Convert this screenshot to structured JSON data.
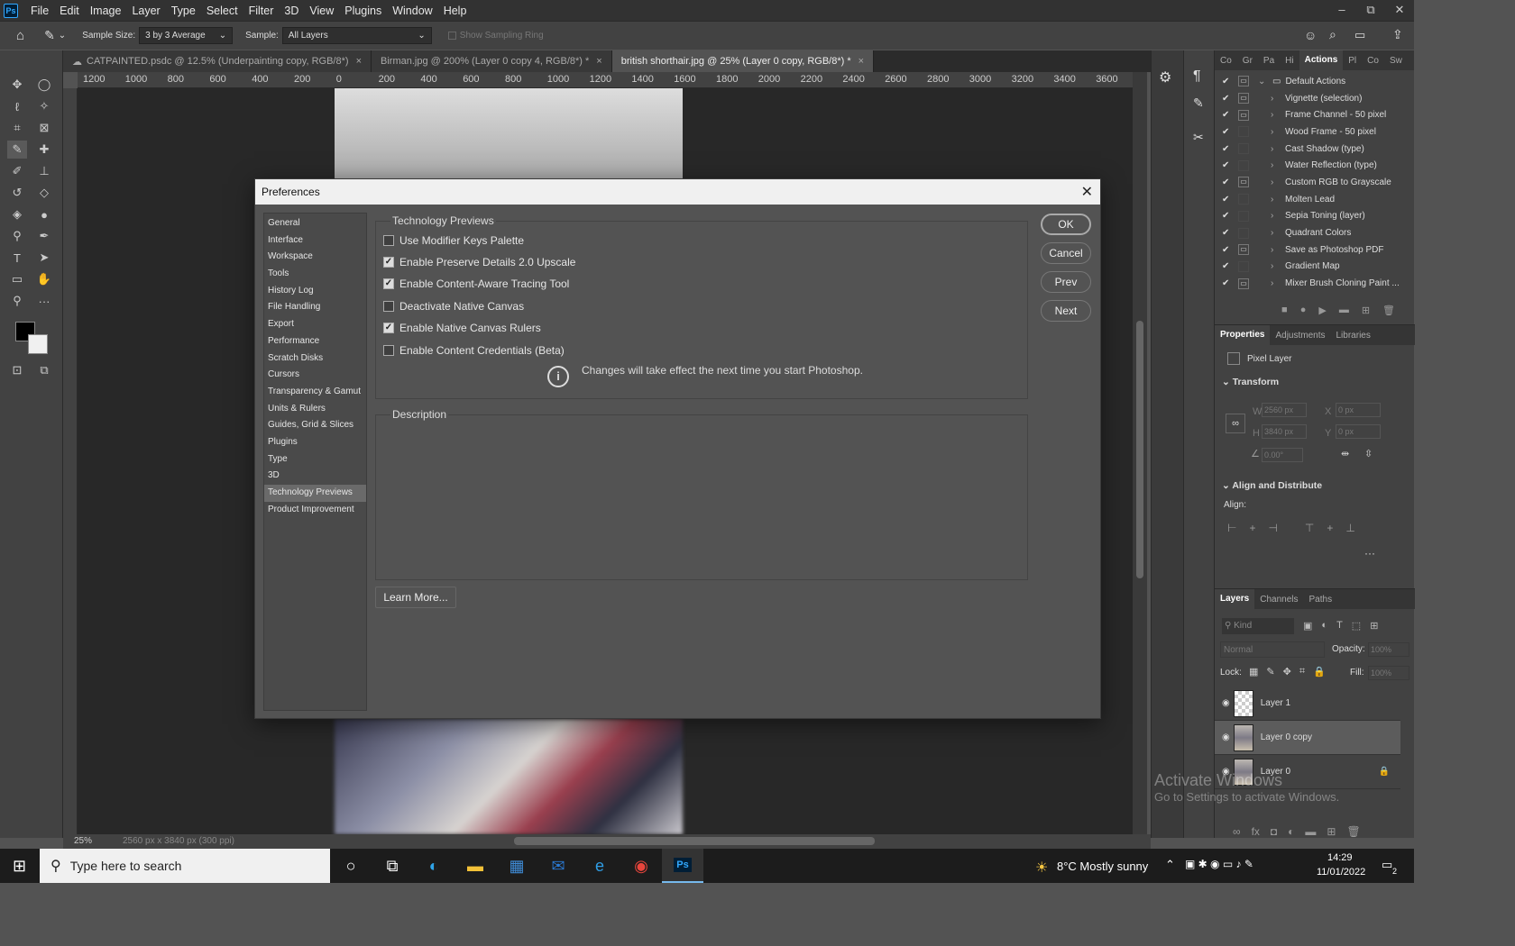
{
  "menubar": {
    "logo": "Ps",
    "items": [
      "File",
      "Edit",
      "Image",
      "Layer",
      "Type",
      "Select",
      "Filter",
      "3D",
      "View",
      "Plugins",
      "Window",
      "Help"
    ],
    "min": "–",
    "max": "⧉",
    "close": "✕"
  },
  "options": {
    "sample_size_label": "Sample Size:",
    "sample_size_value": "3 by 3 Average",
    "sample_label": "Sample:",
    "sample_value": "All Layers",
    "sampling_ring": "Show Sampling Ring"
  },
  "tabs": [
    {
      "label": "CATPAINTED.psdc @ 12.5% (Underpainting copy, RGB/8*)",
      "close": "×"
    },
    {
      "label": "Birman.jpg @ 200% (Layer 0 copy 4, RGB/8*) *",
      "close": "×"
    },
    {
      "label": "british shorthair.jpg @ 25% (Layer 0 copy, RGB/8*) *",
      "close": "×"
    }
  ],
  "ruler": [
    "1200",
    "1000",
    "800",
    "600",
    "400",
    "200",
    "0",
    "200",
    "400",
    "600",
    "800",
    "1000",
    "1200",
    "1400",
    "1600",
    "1800",
    "2000",
    "2200",
    "2400",
    "2600",
    "2800",
    "3000",
    "3200",
    "3400",
    "3600"
  ],
  "status": {
    "zoom": "25%",
    "dims": "2560 px x 3840 px (300 ppi)"
  },
  "actions_panel": {
    "tabs": [
      "Co",
      "Gr",
      "Pa",
      "Hi",
      "Actions",
      "Pl",
      "Co",
      "Sw"
    ],
    "set": "Default Actions",
    "items": [
      "Vignette (selection)",
      "Frame Channel - 50 pixel",
      "Wood Frame - 50 pixel",
      "Cast Shadow (type)",
      "Water Reflection (type)",
      "Custom RGB to Grayscale",
      "Molten Lead",
      "Sepia Toning (layer)",
      "Quadrant Colors",
      "Save as Photoshop PDF",
      "Gradient Map",
      "Mixer Brush Cloning Paint ..."
    ]
  },
  "properties": {
    "tabs": [
      "Properties",
      "Adjustments",
      "Libraries"
    ],
    "kind": "Pixel Layer",
    "transform": "Transform",
    "w_label": "W",
    "w": "2560 px",
    "h_label": "H",
    "h": "3840 px",
    "x_label": "X",
    "x": "0 px",
    "y_label": "Y",
    "y": "0 px",
    "angle": "0.00°",
    "align_title": "Align and Distribute",
    "align_label": "Align:",
    "more": "···"
  },
  "layers": {
    "tabs": [
      "Layers",
      "Channels",
      "Paths"
    ],
    "kind": "Kind",
    "blend": "Normal",
    "opacity_label": "Opacity:",
    "opacity": "100%",
    "lock_label": "Lock:",
    "fill_label": "Fill:",
    "fill": "100%",
    "items": [
      "Layer 1",
      "Layer 0 copy",
      "Layer 0"
    ]
  },
  "dialog": {
    "title": "Preferences",
    "close": "✕",
    "nav": [
      "General",
      "Interface",
      "Workspace",
      "Tools",
      "History Log",
      "File Handling",
      "Export",
      "Performance",
      "Scratch Disks",
      "Cursors",
      "Transparency & Gamut",
      "Units & Rulers",
      "Guides, Grid & Slices",
      "Plugins",
      "Type",
      "3D",
      "Technology Previews",
      "Product Improvement"
    ],
    "selected": "Technology Previews",
    "group_title": "Technology Previews",
    "options": [
      {
        "label": "Use Modifier Keys Palette",
        "checked": false
      },
      {
        "label": "Enable Preserve Details 2.0 Upscale",
        "checked": true
      },
      {
        "label": "Enable Content-Aware Tracing Tool",
        "checked": true
      },
      {
        "label": "Deactivate Native Canvas",
        "checked": false
      },
      {
        "label": "Enable Native Canvas Rulers",
        "checked": true
      },
      {
        "label": "Enable Content Credentials (Beta)",
        "checked": false
      }
    ],
    "note": "Changes will take effect the next time you start Photoshop.",
    "description_title": "Description",
    "learn_more": "Learn More...",
    "ok": "OK",
    "cancel": "Cancel",
    "prev": "Prev",
    "next": "Next"
  },
  "watermark": {
    "line1": "Activate Windows",
    "line2": "Go to Settings to activate Windows."
  },
  "taskbar": {
    "search_placeholder": "Type here to search",
    "weather": "8°C  Mostly sunny",
    "time": "14:29",
    "date": "11/01/2022",
    "notif": "2"
  }
}
